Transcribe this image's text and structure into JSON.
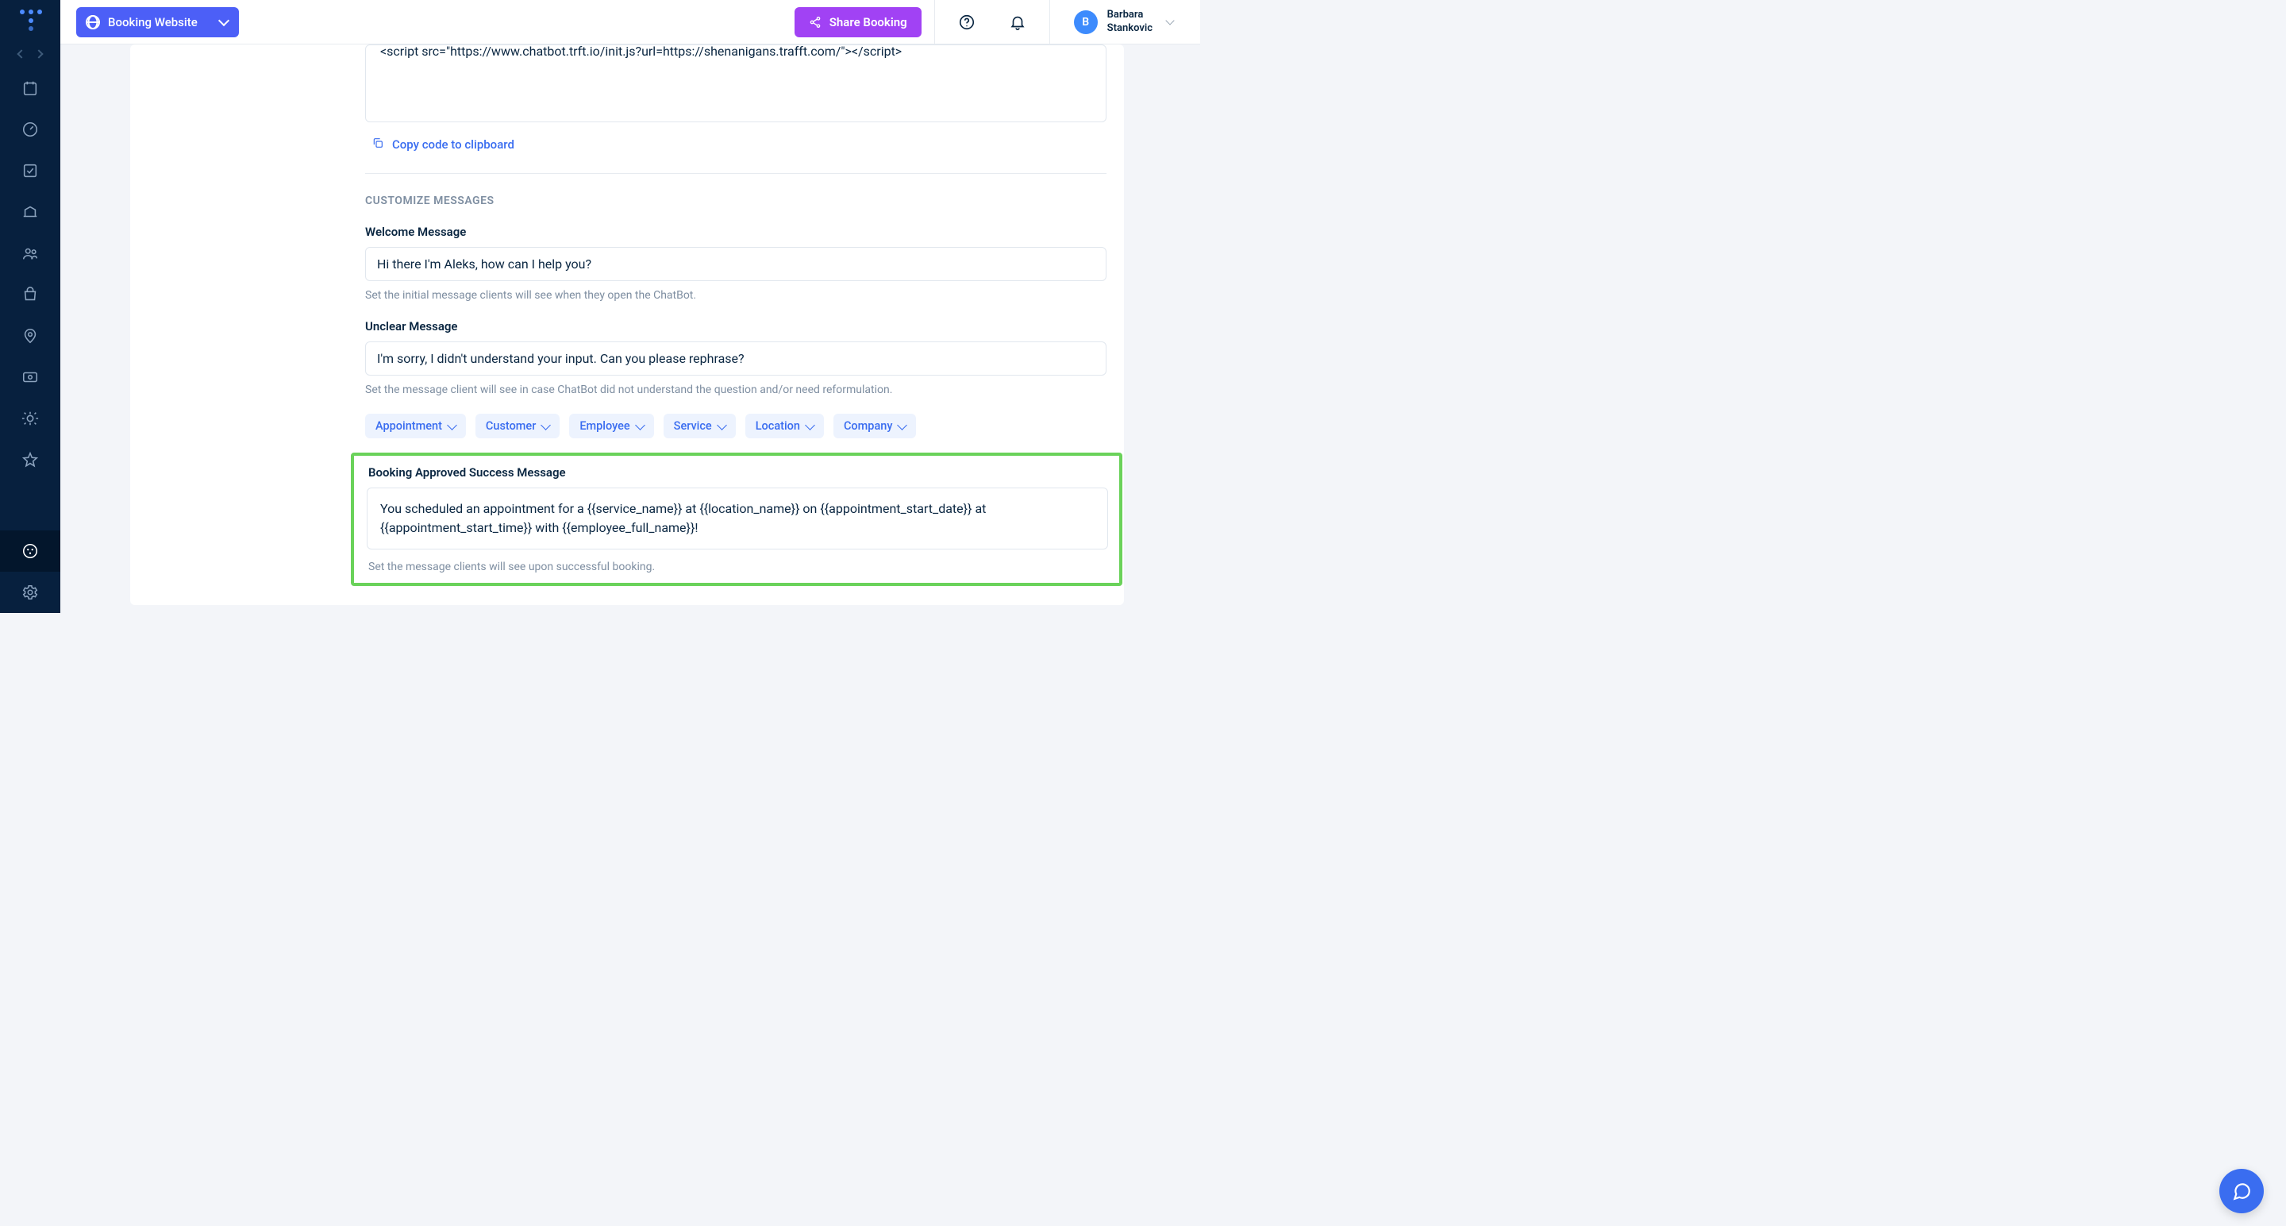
{
  "topbar": {
    "site_button_label": "Booking Website",
    "share_button_label": "Share Booking"
  },
  "user": {
    "initial": "B",
    "first_name": "Barbara",
    "last_name": "Stankovic"
  },
  "code_box": {
    "snippet": "<script src=\"https://www.chatbot.trft.io/init.js?url=https://shenanigans.trafft.com/\"></script>"
  },
  "copy_link_label": "Copy code to clipboard",
  "section_title": "CUSTOMIZE MESSAGES",
  "welcome": {
    "label": "Welcome Message",
    "value": "Hi there I'm Aleks, how can I help you?",
    "help": "Set the initial message clients will see when they open the ChatBot."
  },
  "unclear": {
    "label": "Unclear Message",
    "value": "I'm sorry, I didn't understand your input. Can you please rephrase?",
    "help": "Set the message client will see in case ChatBot did not understand the question and/or need reformulation."
  },
  "chips": [
    "Appointment",
    "Customer",
    "Employee",
    "Service",
    "Location",
    "Company"
  ],
  "approved": {
    "label": "Booking Approved Success Message",
    "value": "You scheduled an appointment for a {{service_name}} at {{location_name}} on {{appointment_start_date}} at {{appointment_start_time}} with {{employee_full_name}}!",
    "help": "Set the message clients will see upon successful booking."
  }
}
